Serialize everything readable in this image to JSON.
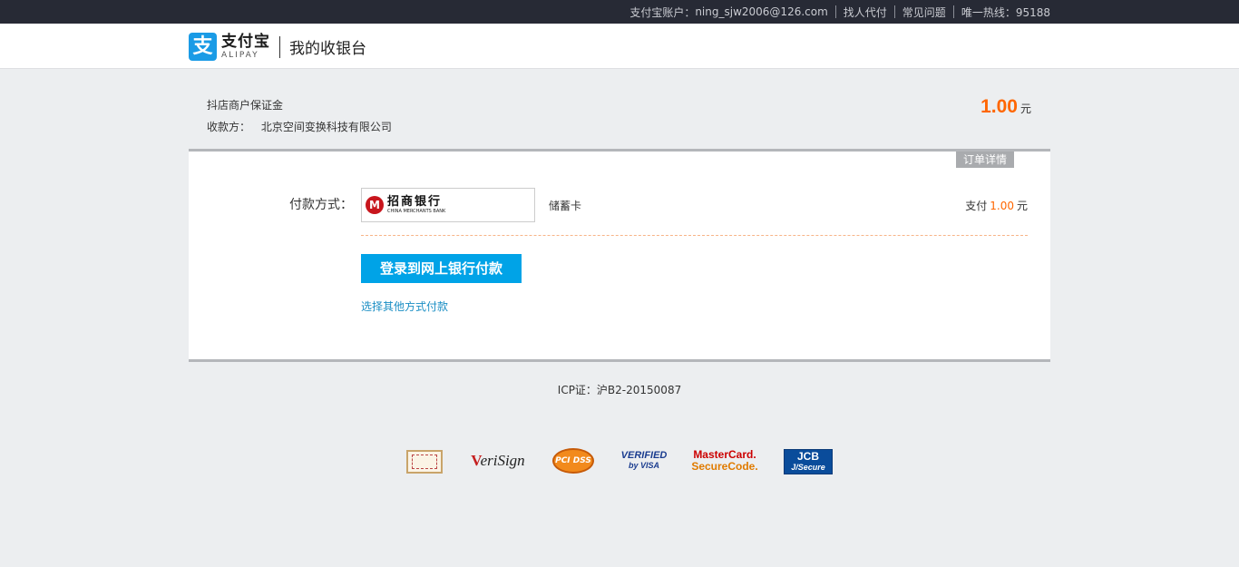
{
  "topbar": {
    "account_label": "支付宝账户：",
    "account_value": "ning_sjw2006@126.com",
    "links": [
      "找人代付",
      "常见问题"
    ],
    "hotline": "唯一热线：95188"
  },
  "header": {
    "logo_mark": "支",
    "logo_cn": "支付宝",
    "logo_en": "ALIPAY",
    "page_name": "我的收银台"
  },
  "order": {
    "title": "抖店商户保证金",
    "payee_label": "收款方：",
    "payee_name": "北京空间变换科技有限公司",
    "amount": "1.00",
    "unit": "元",
    "detail_tab": "订单详情"
  },
  "payment": {
    "method_label": "付款方式：",
    "bank_emblem": "M",
    "bank_cn": "招商银行",
    "bank_en": "CHINA MERCHANTS BANK",
    "card_type": "储蓄卡",
    "pay_prefix": "支付",
    "pay_amount": "1.00",
    "pay_unit": "元",
    "login_button": "登录到网上银行付款",
    "other_link": "选择其他方式付款"
  },
  "footer": {
    "icp": "ICP证：沪B2-20150087",
    "certs": {
      "verisign": "eriSign",
      "pci": "PCI DSS",
      "visa_top": "VERIFIED",
      "visa_bottom": "by VISA",
      "mc_top": "MasterCard.",
      "mc_bottom": "SecureCode.",
      "jcb_top": "JCB",
      "jcb_bottom": "J/Secure"
    }
  }
}
